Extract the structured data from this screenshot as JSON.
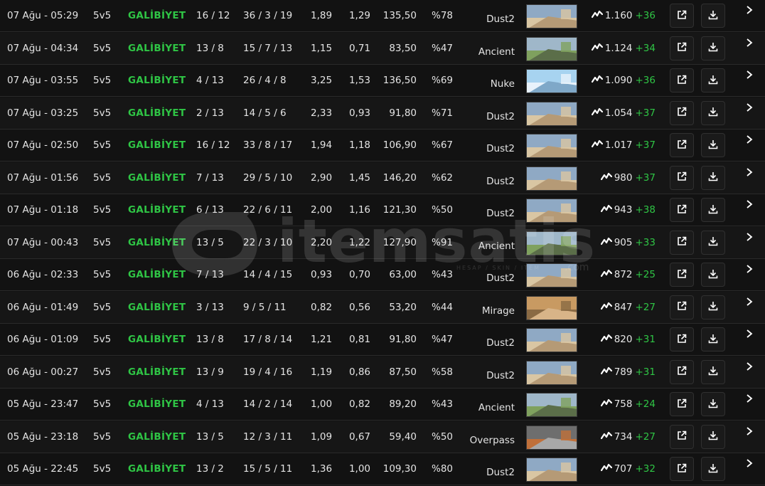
{
  "colors": {
    "win": "#2fc545",
    "gain": "#2fc545",
    "background": "#121212",
    "row_alt": "#161616"
  },
  "icons": {
    "elo": "trend-line-icon",
    "open": "external-link-icon",
    "download": "download-icon",
    "expand": "chevron-right-icon"
  },
  "watermark": {
    "brand": "itemsatis",
    "tagline": "HESAP / SKIN / ITEM",
    "domain": ".com"
  },
  "matches": [
    {
      "date": "07 Ağu - 05:29",
      "mode": "5v5",
      "result": "GALİBİYET",
      "score": "16 / 12",
      "kda": "36 / 3 / 19",
      "kd": "1,89",
      "adr": "1,29",
      "rating": "135,50",
      "hs": "%78",
      "map": "Dust2",
      "elo": "1.160",
      "elo_change": "+36"
    },
    {
      "date": "07 Ağu - 04:34",
      "mode": "5v5",
      "result": "GALİBİYET",
      "score": "13 / 8",
      "kda": "15 / 7 / 13",
      "kd": "1,15",
      "adr": "0,71",
      "rating": "83,50",
      "hs": "%47",
      "map": "Ancient",
      "elo": "1.124",
      "elo_change": "+34"
    },
    {
      "date": "07 Ağu - 03:55",
      "mode": "5v5",
      "result": "GALİBİYET",
      "score": "4 / 13",
      "kda": "26 / 4 / 8",
      "kd": "3,25",
      "adr": "1,53",
      "rating": "136,50",
      "hs": "%69",
      "map": "Nuke",
      "elo": "1.090",
      "elo_change": "+36"
    },
    {
      "date": "07 Ağu - 03:25",
      "mode": "5v5",
      "result": "GALİBİYET",
      "score": "2 / 13",
      "kda": "14 / 5 / 6",
      "kd": "2,33",
      "adr": "0,93",
      "rating": "91,80",
      "hs": "%71",
      "map": "Dust2",
      "elo": "1.054",
      "elo_change": "+37"
    },
    {
      "date": "07 Ağu - 02:50",
      "mode": "5v5",
      "result": "GALİBİYET",
      "score": "16 / 12",
      "kda": "33 / 8 / 17",
      "kd": "1,94",
      "adr": "1,18",
      "rating": "106,90",
      "hs": "%67",
      "map": "Dust2",
      "elo": "1.017",
      "elo_change": "+37"
    },
    {
      "date": "07 Ağu - 01:56",
      "mode": "5v5",
      "result": "GALİBİYET",
      "score": "7 / 13",
      "kda": "29 / 5 / 10",
      "kd": "2,90",
      "adr": "1,45",
      "rating": "146,20",
      "hs": "%62",
      "map": "Dust2",
      "elo": "980",
      "elo_change": "+37"
    },
    {
      "date": "07 Ağu - 01:18",
      "mode": "5v5",
      "result": "GALİBİYET",
      "score": "6 / 13",
      "kda": "22 / 6 / 11",
      "kd": "2,00",
      "adr": "1,16",
      "rating": "121,30",
      "hs": "%50",
      "map": "Dust2",
      "elo": "943",
      "elo_change": "+38"
    },
    {
      "date": "07 Ağu - 00:43",
      "mode": "5v5",
      "result": "GALİBİYET",
      "score": "13 / 5",
      "kda": "22 / 3 / 10",
      "kd": "2,20",
      "adr": "1,22",
      "rating": "127,90",
      "hs": "%91",
      "map": "Ancient",
      "elo": "905",
      "elo_change": "+33"
    },
    {
      "date": "06 Ağu - 02:33",
      "mode": "5v5",
      "result": "GALİBİYET",
      "score": "7 / 13",
      "kda": "14 / 4 / 15",
      "kd": "0,93",
      "adr": "0,70",
      "rating": "63,00",
      "hs": "%43",
      "map": "Dust2",
      "elo": "872",
      "elo_change": "+25"
    },
    {
      "date": "06 Ağu - 01:49",
      "mode": "5v5",
      "result": "GALİBİYET",
      "score": "3 / 13",
      "kda": "9 / 5 / 11",
      "kd": "0,82",
      "adr": "0,56",
      "rating": "53,20",
      "hs": "%44",
      "map": "Mirage",
      "elo": "847",
      "elo_change": "+27"
    },
    {
      "date": "06 Ağu - 01:09",
      "mode": "5v5",
      "result": "GALİBİYET",
      "score": "13 / 8",
      "kda": "17 / 8 / 14",
      "kd": "1,21",
      "adr": "0,81",
      "rating": "91,80",
      "hs": "%47",
      "map": "Dust2",
      "elo": "820",
      "elo_change": "+31"
    },
    {
      "date": "06 Ağu - 00:27",
      "mode": "5v5",
      "result": "GALİBİYET",
      "score": "13 / 9",
      "kda": "19 / 4 / 16",
      "kd": "1,19",
      "adr": "0,86",
      "rating": "87,50",
      "hs": "%58",
      "map": "Dust2",
      "elo": "789",
      "elo_change": "+31"
    },
    {
      "date": "05 Ağu - 23:47",
      "mode": "5v5",
      "result": "GALİBİYET",
      "score": "4 / 13",
      "kda": "14 / 2 / 14",
      "kd": "1,00",
      "adr": "0,82",
      "rating": "89,20",
      "hs": "%43",
      "map": "Ancient",
      "elo": "758",
      "elo_change": "+24"
    },
    {
      "date": "05 Ağu - 23:18",
      "mode": "5v5",
      "result": "GALİBİYET",
      "score": "13 / 5",
      "kda": "12 / 3 / 11",
      "kd": "1,09",
      "adr": "0,67",
      "rating": "59,40",
      "hs": "%50",
      "map": "Overpass",
      "elo": "734",
      "elo_change": "+27"
    },
    {
      "date": "05 Ağu - 22:45",
      "mode": "5v5",
      "result": "GALİBİYET",
      "score": "13 / 2",
      "kda": "15 / 5 / 11",
      "kd": "1,36",
      "adr": "1,00",
      "rating": "109,30",
      "hs": "%80",
      "map": "Dust2",
      "elo": "707",
      "elo_change": "+32"
    }
  ]
}
